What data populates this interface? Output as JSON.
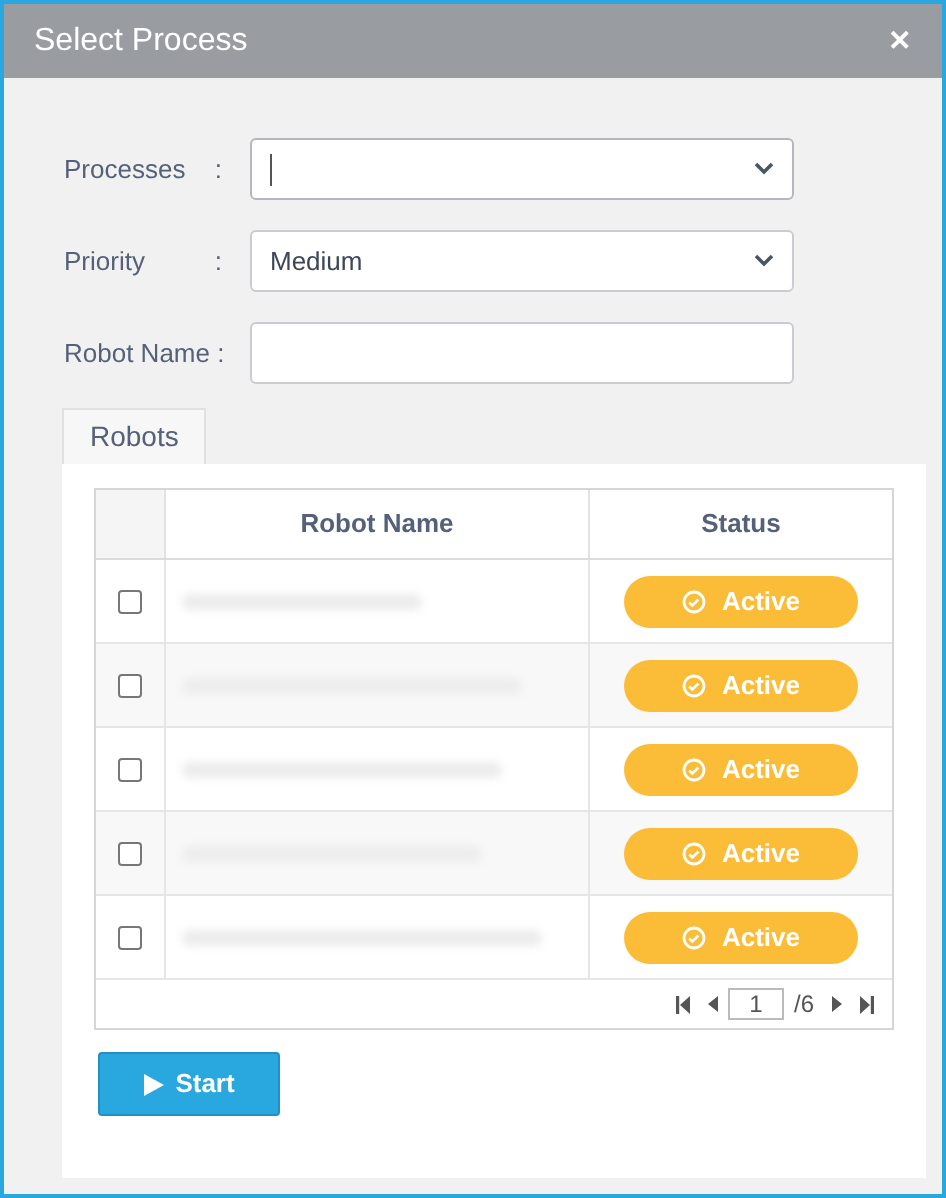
{
  "window": {
    "title": "Select Process",
    "close": "✕"
  },
  "form": [
    {
      "label": "Processes",
      "colon": ":",
      "kind": "select",
      "focused": true
    },
    {
      "label": "Priority",
      "colon": ":",
      "kind": "select",
      "value": "Medium",
      "focused": false
    },
    {
      "label": "Robot Name :",
      "kind": "text",
      "focused": false
    }
  ],
  "tabs": [
    {
      "label": "Robots",
      "selected": true
    }
  ],
  "table": {
    "columns": [
      "Robot Name",
      "Status"
    ],
    "rows": [
      {
        "checked": false,
        "status": "Active"
      },
      {
        "checked": false,
        "status": "Active"
      },
      {
        "checked": false,
        "status": "Active"
      },
      {
        "checked": false,
        "status": "Active"
      },
      {
        "checked": false,
        "status": "Active"
      }
    ]
  },
  "pager": {
    "page": "1",
    "total": "/6"
  },
  "start_button": "Start"
}
